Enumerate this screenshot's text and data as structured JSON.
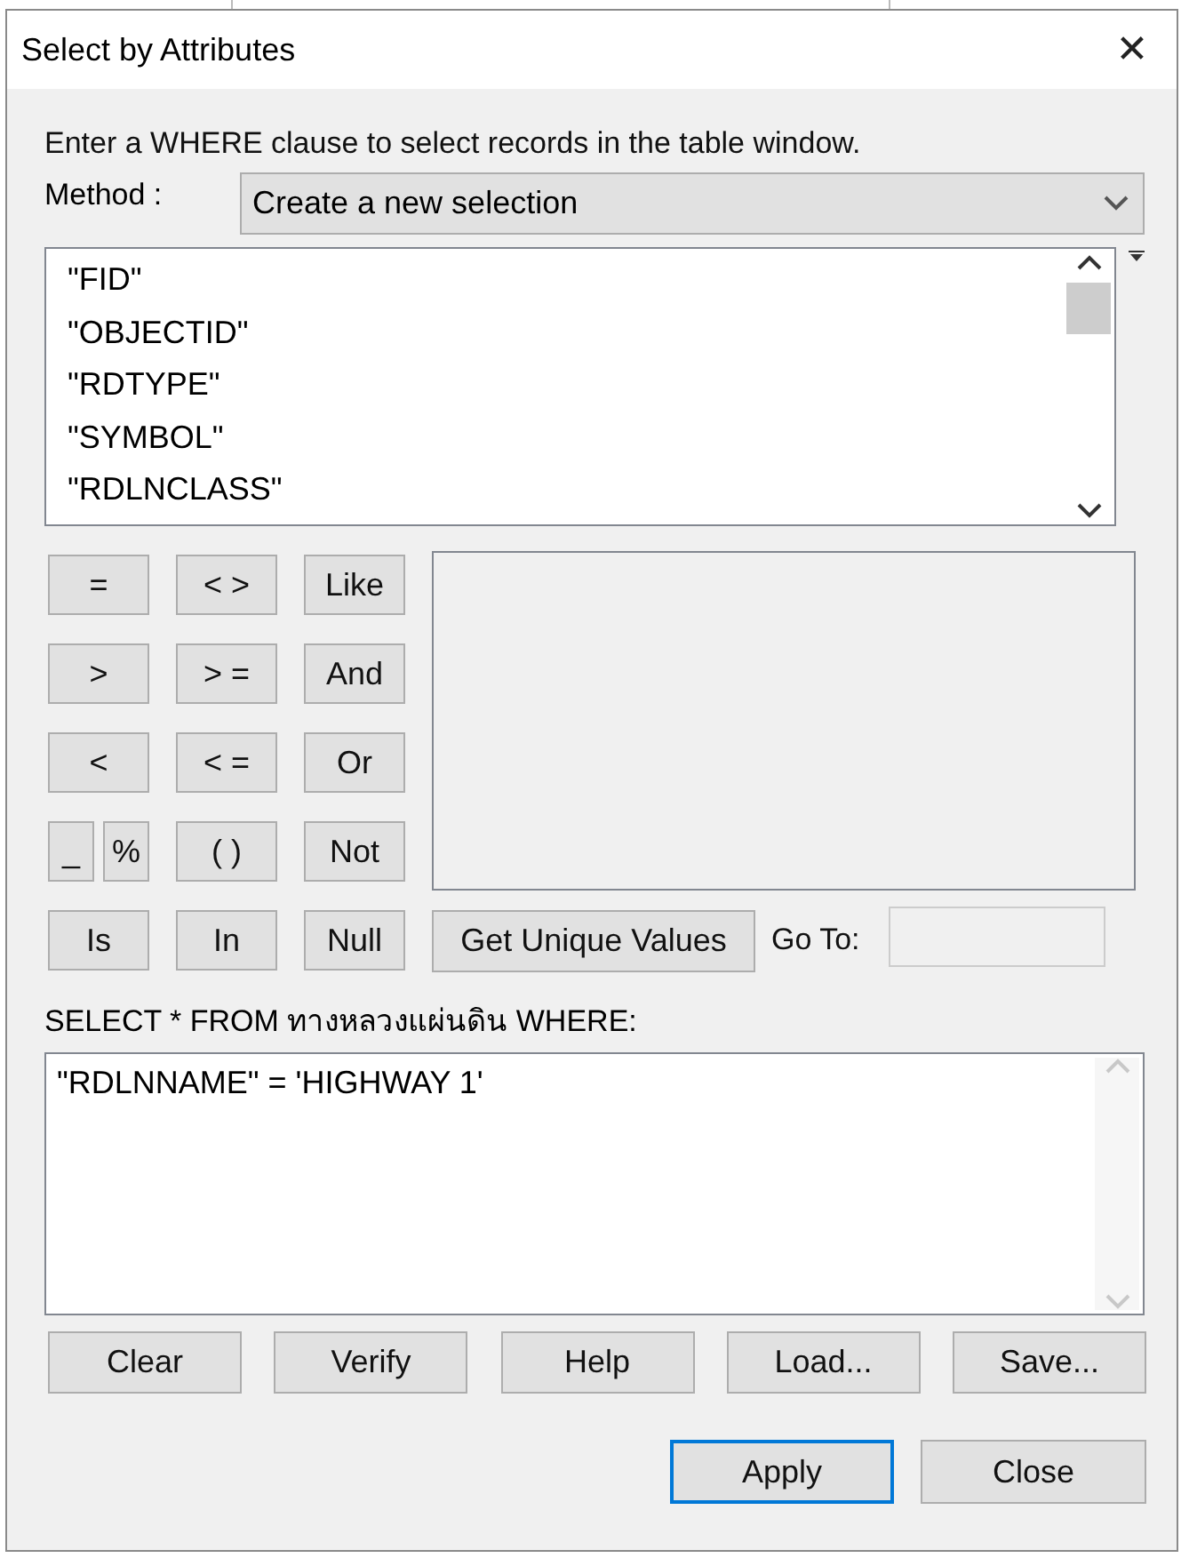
{
  "window": {
    "title": "Select by Attributes",
    "close": "✕"
  },
  "instruction": "Enter a WHERE clause to select records in the table window.",
  "method": {
    "label": "Method :",
    "value": "Create a new selection"
  },
  "fields": [
    "\"FID\"",
    "\"OBJECTID\"",
    "\"RDTYPE\"",
    "\"SYMBOL\"",
    "\"RDLNCLASS\""
  ],
  "operator_rows": [
    [
      {
        "label": "=",
        "kind": "full"
      },
      {
        "label": "< >",
        "kind": "full"
      },
      {
        "label": "Like",
        "kind": "full"
      }
    ],
    [
      {
        "label": ">",
        "kind": "full"
      },
      {
        "label": "> =",
        "kind": "full"
      },
      {
        "label": "And",
        "kind": "full"
      }
    ],
    [
      {
        "label": "<",
        "kind": "full"
      },
      {
        "label": "< =",
        "kind": "full"
      },
      {
        "label": "Or",
        "kind": "full"
      }
    ],
    [
      {
        "label": "_",
        "kind": "half"
      },
      {
        "label": "%",
        "kind": "half"
      },
      {
        "label": "( )",
        "kind": "full"
      },
      {
        "label": "Not",
        "kind": "full"
      }
    ],
    [
      {
        "label": "Is",
        "kind": "full"
      },
      {
        "label": "In",
        "kind": "full"
      },
      {
        "label": "Null",
        "kind": "full"
      }
    ]
  ],
  "unique_values_button": "Get Unique Values",
  "goto": {
    "label": "Go To:"
  },
  "query": {
    "label": "SELECT * FROM ทางหลวงแผ่นดิน WHERE:",
    "expression": "\"RDLNNAME\" = 'HIGHWAY 1'"
  },
  "buttons": [
    "Clear",
    "Verify",
    "Help",
    "Load...",
    "Save..."
  ],
  "dialog_buttons": [
    {
      "label": "Apply",
      "focused": true
    },
    {
      "label": "Close",
      "focused": false
    }
  ]
}
